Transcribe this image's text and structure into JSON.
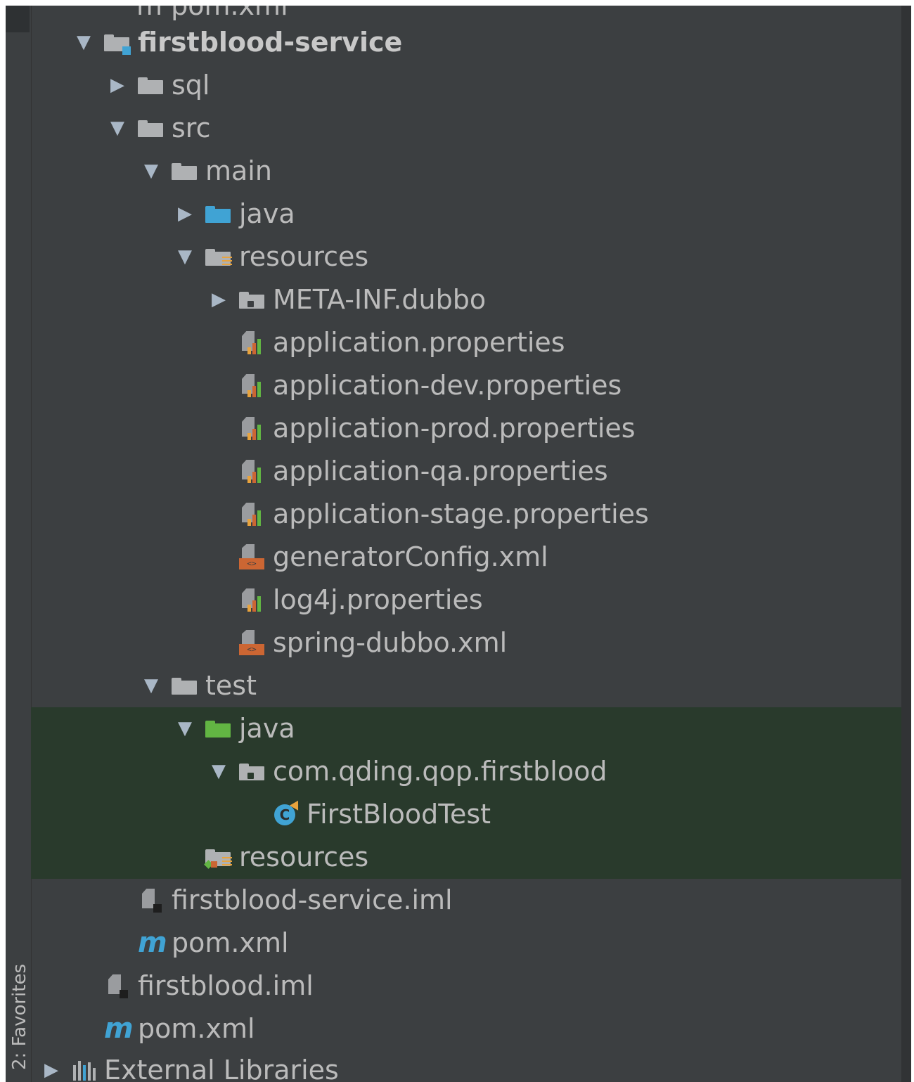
{
  "sidebar": {
    "favorites_label": "2: Favorites"
  },
  "top_partial": "m pom.xml",
  "tree": [
    {
      "label": "firstblood-service",
      "icon": "module-folder-icon",
      "expand": "expanded"
    },
    {
      "label": "sql",
      "icon": "folder-icon",
      "expand": "collapsed"
    },
    {
      "label": "src",
      "icon": "folder-icon",
      "expand": "expanded"
    },
    {
      "label": "main",
      "icon": "folder-icon",
      "expand": "expanded"
    },
    {
      "label": "java",
      "icon": "source-folder-icon",
      "expand": "collapsed"
    },
    {
      "label": "resources",
      "icon": "resources-folder-icon",
      "expand": "expanded"
    },
    {
      "label": "META-INF.dubbo",
      "icon": "package-icon",
      "expand": "collapsed"
    },
    {
      "label": "application.properties",
      "icon": "properties-file-icon"
    },
    {
      "label": "application-dev.properties",
      "icon": "properties-file-icon"
    },
    {
      "label": "application-prod.properties",
      "icon": "properties-file-icon"
    },
    {
      "label": "application-qa.properties",
      "icon": "properties-file-icon"
    },
    {
      "label": "application-stage.properties",
      "icon": "properties-file-icon"
    },
    {
      "label": "generatorConfig.xml",
      "icon": "xml-file-icon"
    },
    {
      "label": "log4j.properties",
      "icon": "properties-file-icon"
    },
    {
      "label": "spring-dubbo.xml",
      "icon": "xml-file-icon"
    },
    {
      "label": "test",
      "icon": "folder-icon",
      "expand": "expanded"
    },
    {
      "label": "java",
      "icon": "test-source-folder-icon",
      "expand": "expanded"
    },
    {
      "label": "com.qding.qop.firstblood",
      "icon": "package-icon",
      "expand": "expanded"
    },
    {
      "label": "FirstBloodTest",
      "icon": "test-class-icon"
    },
    {
      "label": "resources",
      "icon": "test-resources-folder-icon"
    },
    {
      "label": "firstblood-service.iml",
      "icon": "iml-file-icon"
    },
    {
      "label": "pom.xml",
      "icon": "maven-pom-icon"
    },
    {
      "label": "firstblood.iml",
      "icon": "iml-file-icon"
    },
    {
      "label": "pom.xml",
      "icon": "maven-pom-icon"
    },
    {
      "label": "External Libraries",
      "icon": "external-libraries-icon",
      "expand": "collapsed"
    }
  ],
  "colors": {
    "background": "#3c3f41",
    "selection_green": "#293a2c",
    "text": "#bbbbbb",
    "folder_gray": "#afb1b3",
    "source_blue": "#40a3d4",
    "test_green": "#62b543",
    "accent_orange": "#e8a33d"
  }
}
